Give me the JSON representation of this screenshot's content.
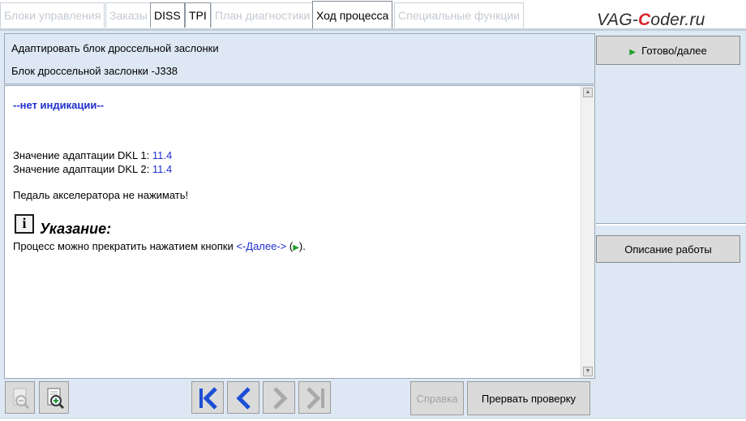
{
  "tabs": [
    {
      "label": "Блоки управления",
      "state": "disabled"
    },
    {
      "label": "Заказы",
      "state": "disabled"
    },
    {
      "label": "DISS",
      "state": "enabled"
    },
    {
      "label": "TPI",
      "state": "enabled"
    },
    {
      "label": "План диагностики",
      "state": "disabled"
    },
    {
      "label": "Ход процесса",
      "state": "active"
    },
    {
      "label": "Специальные функции",
      "state": "disabled"
    }
  ],
  "brand": {
    "before": "VAG-",
    "c": "C",
    "after": "oder.ru"
  },
  "header": {
    "title": "Адаптировать блок дроссельной заслонки",
    "subtitle": "Блок дроссельной заслонки -J338"
  },
  "content": {
    "no_indication": "--нет индикации--",
    "dkl1_label": "Значение адаптации DKL 1: ",
    "dkl1_value": "11.4",
    "dkl2_label": "Значение адаптации DKL 2: ",
    "dkl2_value": "11.4",
    "pedal_warning": "Педаль акселератора не нажимать!",
    "info_icon_glyph": "i",
    "hint_title": "Указание:",
    "hint_text_before": "Процесс можно прекратить нажатием кнопки ",
    "hint_link": "<-Далее->",
    "hint_open": " (",
    "hint_close": ")."
  },
  "right_panel": {
    "ready_label": "Готово/далее",
    "description_label": "Описание работы"
  },
  "toolbar": {
    "help_label": "Справка",
    "abort_label": "Прервать проверку"
  },
  "icons": {
    "zoom_out": "zoom-out-icon",
    "zoom_in": "zoom-in-icon",
    "first": "skip-first-icon",
    "back": "chevron-left-icon",
    "forward": "chevron-right-icon",
    "last": "skip-last-icon",
    "play": "play-triangle-icon"
  },
  "colors": {
    "accent_blue": "#1f2fd0",
    "nav_blue": "#1d4fd6",
    "play_green": "#23a02c",
    "panel_bg": "#dde8f4"
  }
}
